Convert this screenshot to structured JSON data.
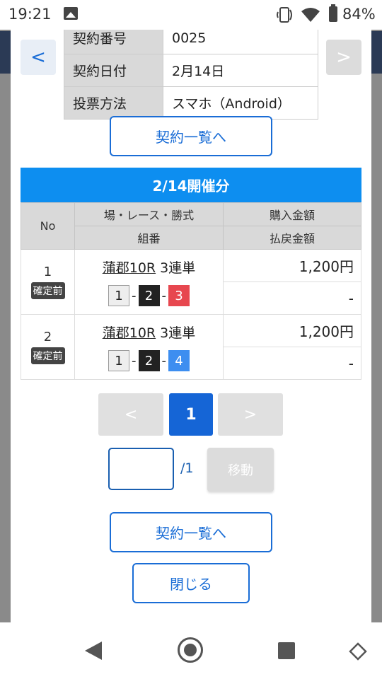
{
  "status_bar": {
    "time": "19:21",
    "battery": "84%"
  },
  "info": {
    "rows": [
      {
        "label": "契約番号",
        "value": "0025"
      },
      {
        "label": "契約日付",
        "value": "2月14日"
      },
      {
        "label": "投票方法",
        "value": "スマホ（Android）"
      }
    ]
  },
  "nav": {
    "prev_label": "<",
    "next_label": ">"
  },
  "buttons": {
    "contract_list": "契約一覧へ",
    "close": "閉じる"
  },
  "section": {
    "title": "2/14開催分",
    "headers": {
      "no": "No",
      "race": "場・レース・勝式",
      "combo": "組番",
      "purchase": "購入金額",
      "payout": "払戻金額"
    },
    "bets": [
      {
        "no": "1",
        "status": "確定前",
        "venue_race": "蒲郡10R",
        "bet_type": "3連単",
        "combo": [
          "1",
          "2",
          "3"
        ],
        "purchase": "1,200円",
        "payout": "-"
      },
      {
        "no": "2",
        "status": "確定前",
        "venue_race": "蒲郡10R",
        "bet_type": "3連単",
        "combo": [
          "1",
          "2",
          "4"
        ],
        "purchase": "1,200円",
        "payout": "-"
      }
    ]
  },
  "pager": {
    "prev": "<",
    "current": "1",
    "next": ">",
    "input_value": "",
    "total": "/1",
    "move": "移動"
  }
}
